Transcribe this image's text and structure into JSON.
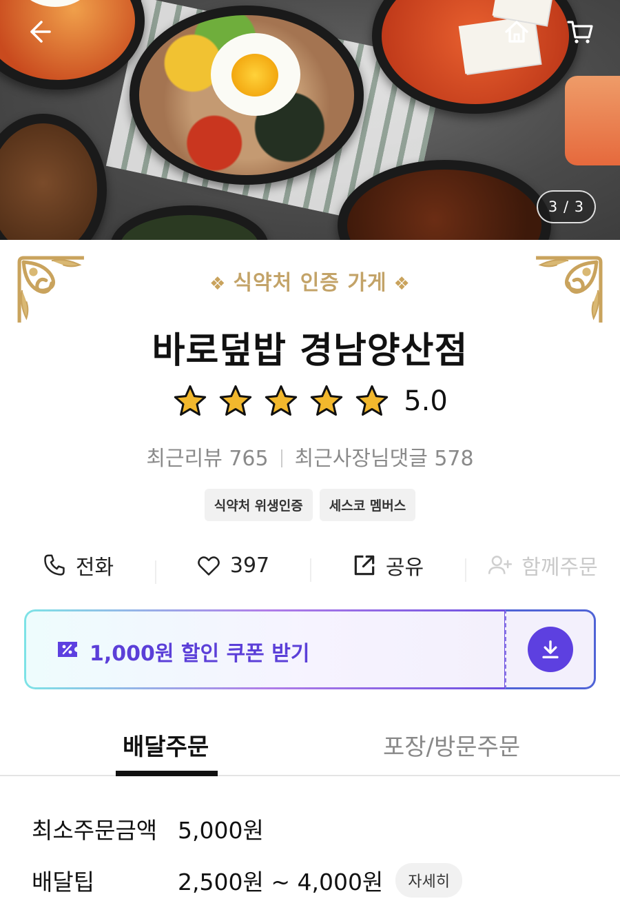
{
  "hero": {
    "page_counter": "3 / 3"
  },
  "store": {
    "certification": "식약처 인증 가게",
    "name": "바로덮밥 경남양산점",
    "rating_value": "5.0",
    "rating_stars": 5,
    "recent_reviews": "최근리뷰 765",
    "owner_replies": "최근사장님댓글 578",
    "badges": [
      "식약처 위생인증",
      "세스코 멤버스"
    ]
  },
  "actions": {
    "call": "전화",
    "likes": "397",
    "share": "공유",
    "group_order": "함께주문"
  },
  "coupon": {
    "label": "1,000원 할인 쿠폰 받기",
    "accent": "#5d40e0"
  },
  "tabs": {
    "delivery": "배달주문",
    "pickup": "포장/방문주문"
  },
  "delivery_info": {
    "min_order_label": "최소주문금액",
    "min_order_value": "5,000원",
    "tip_label": "배달팁",
    "tip_value": "2,500원 ~ 4,000원",
    "detail_button": "자세히"
  },
  "icons": [
    "back-arrow-icon",
    "home-icon",
    "cart-icon",
    "star-icon",
    "phone-icon",
    "heart-icon",
    "share-icon",
    "add-user-icon",
    "coupon-icon",
    "download-icon",
    "ornament-icon",
    "leaf-icon"
  ]
}
